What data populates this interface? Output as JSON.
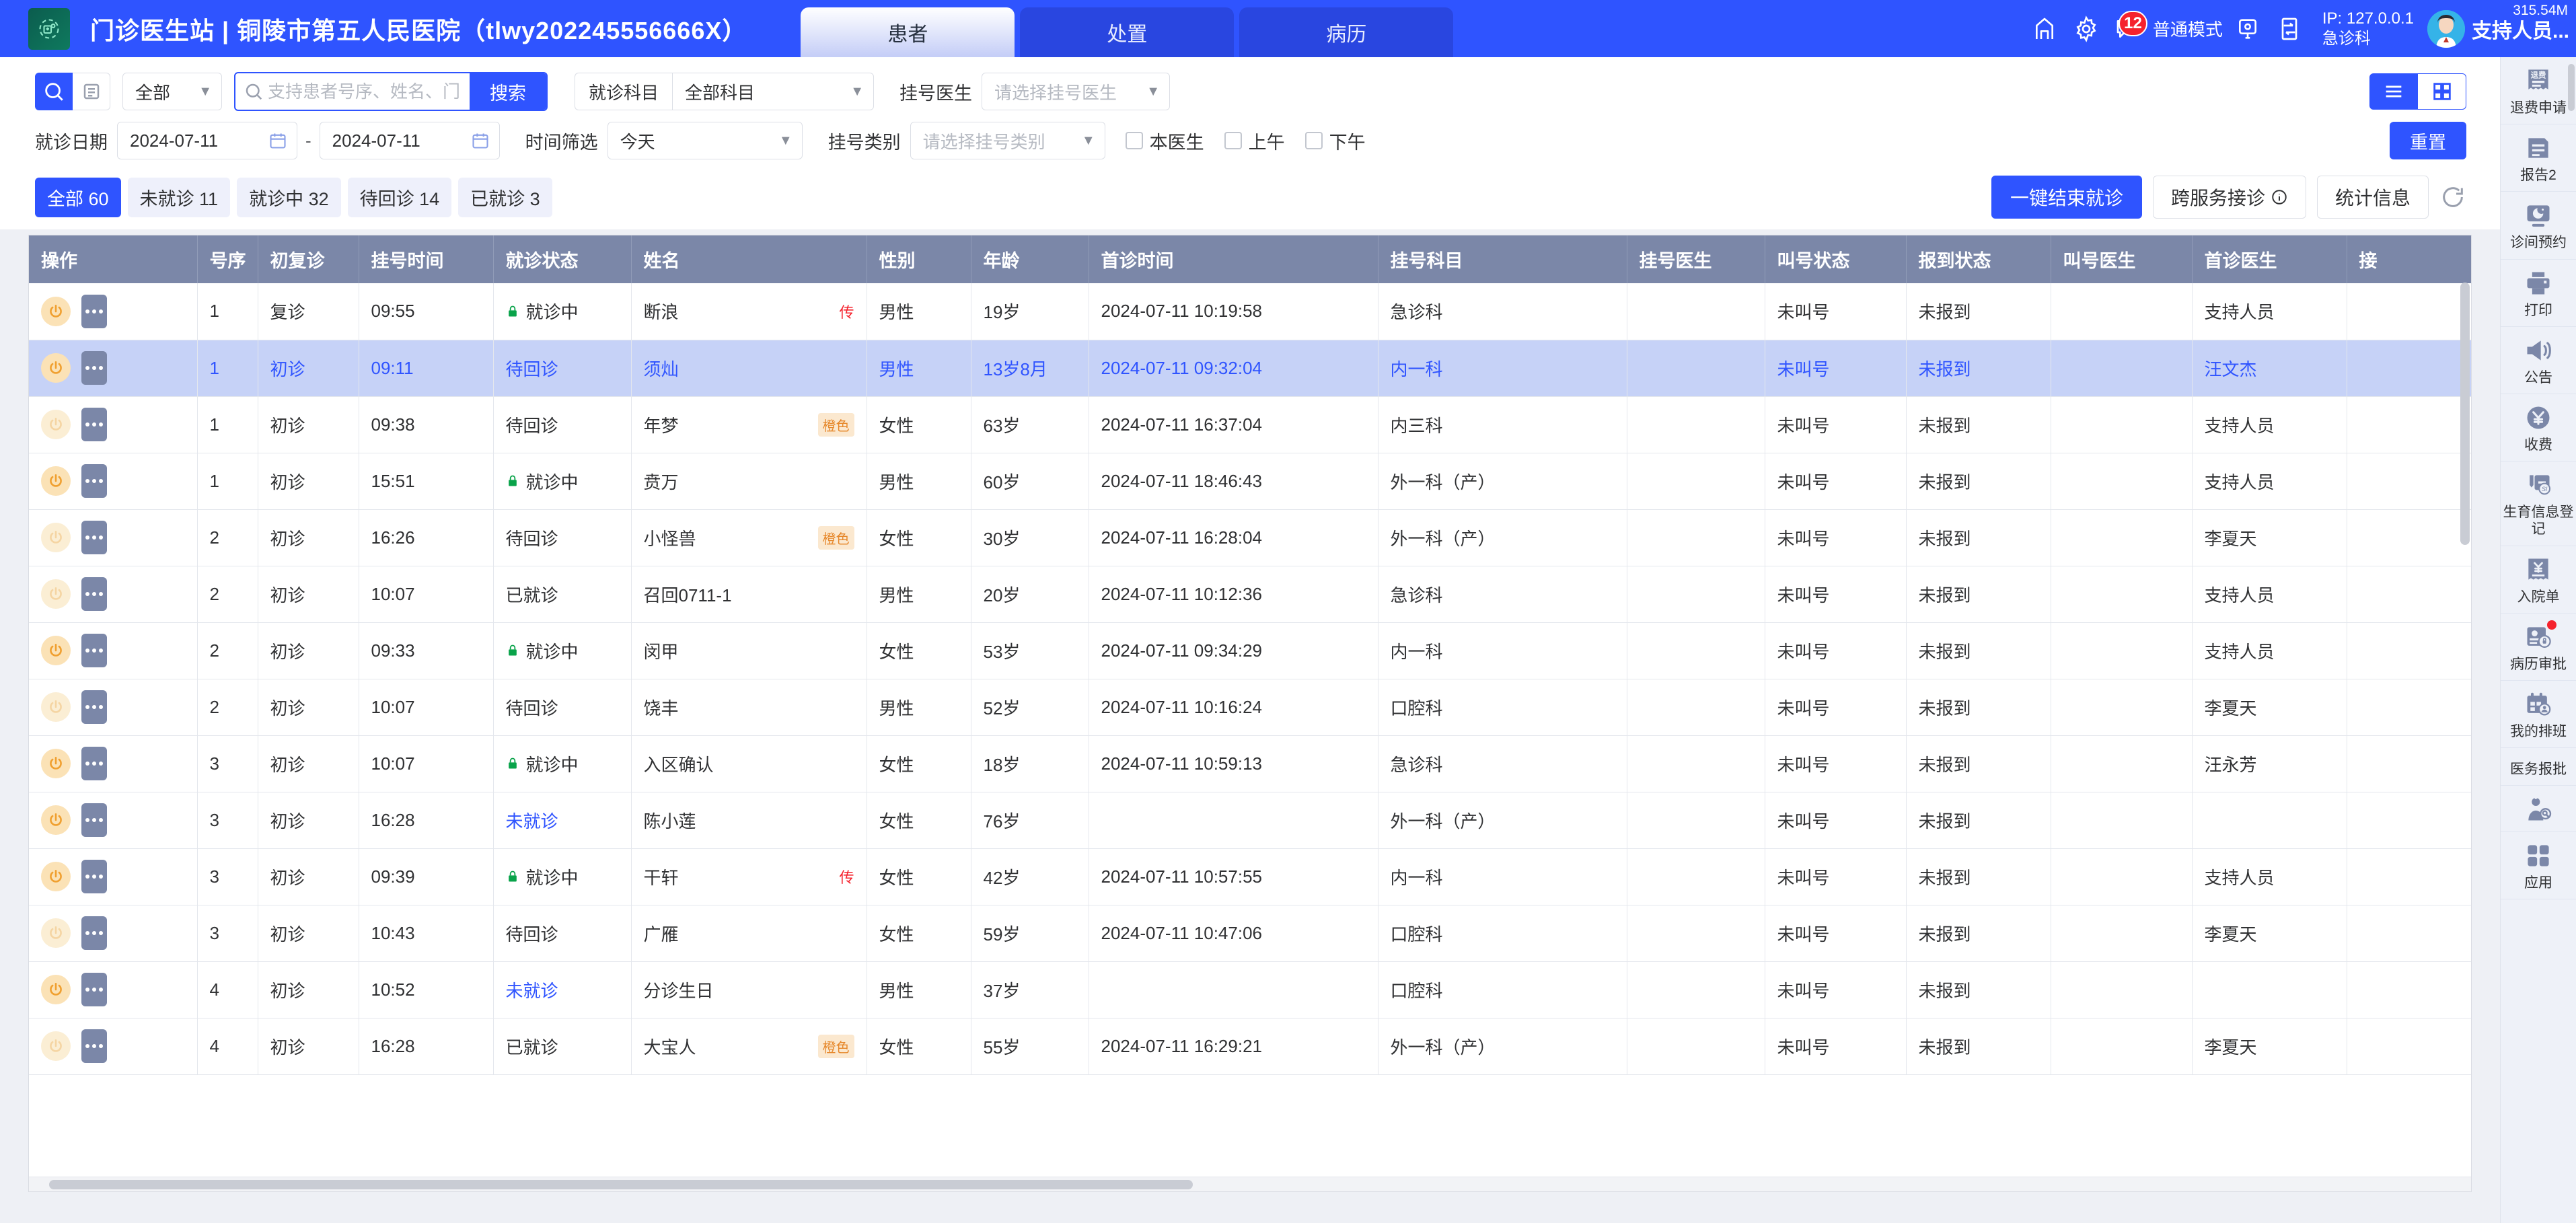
{
  "header": {
    "logo_icon": "hospital-logo-icon",
    "title": "门诊医生站 | 铜陵市第五人民医院（tlwy202245556666X）",
    "tabs": [
      {
        "label": "患者",
        "active": true
      },
      {
        "label": "处置",
        "active": false
      },
      {
        "label": "病历",
        "active": false
      }
    ],
    "icons": {
      "home": "home-icon",
      "settings": "gear-icon",
      "message": "message-icon",
      "screen": "screen-icon",
      "switch": "switch-icon"
    },
    "message_count": "12",
    "mode_label": "普通模式",
    "ip_line1": "IP: 127.0.0.1",
    "ip_line2": "急诊科",
    "user_name": "支持人员...",
    "memory": "315.54M"
  },
  "filters": {
    "search_icon": "search-icon",
    "list_icon": "list-icon",
    "scope_select": "全部",
    "search_placeholder": "支持患者号序、姓名、门",
    "search_value": "",
    "search_button": "搜索",
    "dept_label": "就诊科目",
    "dept_value": "全部科目",
    "reg_doctor_label": "挂号医生",
    "reg_doctor_placeholder": "请选择挂号医生",
    "view_list_icon": "list-view-icon",
    "view_grid_icon": "grid-view-icon",
    "visit_date_label": "就诊日期",
    "date_start": "2024-07-11",
    "date_end": "2024-07-11",
    "date_sep": "-",
    "calendar_icon": "calendar-icon",
    "time_filter_label": "时间筛选",
    "time_filter_value": "今天",
    "reg_type_label": "挂号类别",
    "reg_type_placeholder": "请选择挂号类别",
    "checkboxes": [
      {
        "label": "本医生",
        "checked": false
      },
      {
        "label": "上午",
        "checked": false
      },
      {
        "label": "下午",
        "checked": false
      }
    ],
    "reset_button": "重置"
  },
  "status_tabs": [
    {
      "label": "全部 60",
      "active": true
    },
    {
      "label": "未就诊 11",
      "active": false
    },
    {
      "label": "就诊中 32",
      "active": false
    },
    {
      "label": "待回诊 14",
      "active": false
    },
    {
      "label": "已就诊 3",
      "active": false
    }
  ],
  "actions": {
    "end_visit": "一键结束就诊",
    "cross_service": "跨服务接诊",
    "info_icon": "info-icon",
    "statistics": "统计信息",
    "refresh_icon": "refresh-icon"
  },
  "table": {
    "columns": [
      "操作",
      "号序",
      "初复诊",
      "挂号时间",
      "就诊状态",
      "姓名",
      "性别",
      "年龄",
      "首诊时间",
      "挂号科目",
      "挂号医生",
      "叫号状态",
      "报到状态",
      "叫号医生",
      "首诊医生",
      "接"
    ],
    "rows": [
      {
        "seq": "1",
        "visit_type": "复诊",
        "reg_time": "09:55",
        "status": "就诊中",
        "status_kind": "active",
        "name": "断浪",
        "name_tag": "传",
        "tag_kind": "chuan",
        "gender": "男性",
        "age": "19岁",
        "first_visit_time": "2024-07-11 10:19:58",
        "reg_dept": "急诊科",
        "reg_doctor": "",
        "call_status": "未叫号",
        "checkin_status": "未报到",
        "call_doctor": "",
        "first_doctor": "支持人员",
        "selected": false,
        "power_dim": false
      },
      {
        "seq": "1",
        "visit_type": "初诊",
        "reg_time": "09:11",
        "status": "待回诊",
        "status_kind": "plain",
        "name": "须灿",
        "name_tag": "",
        "tag_kind": "",
        "gender": "男性",
        "age": "13岁8月",
        "first_visit_time": "2024-07-11 09:32:04",
        "reg_dept": "内一科",
        "reg_doctor": "",
        "call_status": "未叫号",
        "checkin_status": "未报到",
        "call_doctor": "",
        "first_doctor": "汪文杰",
        "selected": true,
        "power_dim": false
      },
      {
        "seq": "1",
        "visit_type": "初诊",
        "reg_time": "09:38",
        "status": "待回诊",
        "status_kind": "plain",
        "name": "年梦",
        "name_tag": "橙色",
        "tag_kind": "orange",
        "gender": "女性",
        "age": "63岁",
        "first_visit_time": "2024-07-11 16:37:04",
        "reg_dept": "内三科",
        "reg_doctor": "",
        "call_status": "未叫号",
        "checkin_status": "未报到",
        "call_doctor": "",
        "first_doctor": "支持人员",
        "selected": false,
        "power_dim": true
      },
      {
        "seq": "1",
        "visit_type": "初诊",
        "reg_time": "15:51",
        "status": "就诊中",
        "status_kind": "active",
        "name": "贲万",
        "name_tag": "",
        "tag_kind": "",
        "gender": "男性",
        "age": "60岁",
        "first_visit_time": "2024-07-11 18:46:43",
        "reg_dept": "外一科（产）",
        "reg_doctor": "",
        "call_status": "未叫号",
        "checkin_status": "未报到",
        "call_doctor": "",
        "first_doctor": "支持人员",
        "selected": false,
        "power_dim": false
      },
      {
        "seq": "2",
        "visit_type": "初诊",
        "reg_time": "16:26",
        "status": "待回诊",
        "status_kind": "plain",
        "name": "小怪兽",
        "name_tag": "橙色",
        "tag_kind": "orange",
        "gender": "女性",
        "age": "30岁",
        "first_visit_time": "2024-07-11 16:28:04",
        "reg_dept": "外一科（产）",
        "reg_doctor": "",
        "call_status": "未叫号",
        "checkin_status": "未报到",
        "call_doctor": "",
        "first_doctor": "李夏天",
        "selected": false,
        "power_dim": true
      },
      {
        "seq": "2",
        "visit_type": "初诊",
        "reg_time": "10:07",
        "status": "已就诊",
        "status_kind": "plain",
        "name": "召回0711-1",
        "name_tag": "",
        "tag_kind": "",
        "gender": "男性",
        "age": "20岁",
        "first_visit_time": "2024-07-11 10:12:36",
        "reg_dept": "急诊科",
        "reg_doctor": "",
        "call_status": "未叫号",
        "checkin_status": "未报到",
        "call_doctor": "",
        "first_doctor": "支持人员",
        "selected": false,
        "power_dim": true
      },
      {
        "seq": "2",
        "visit_type": "初诊",
        "reg_time": "09:33",
        "status": "就诊中",
        "status_kind": "active",
        "name": "闵甲",
        "name_tag": "",
        "tag_kind": "",
        "gender": "女性",
        "age": "53岁",
        "first_visit_time": "2024-07-11 09:34:29",
        "reg_dept": "内一科",
        "reg_doctor": "",
        "call_status": "未叫号",
        "checkin_status": "未报到",
        "call_doctor": "",
        "first_doctor": "支持人员",
        "selected": false,
        "power_dim": false
      },
      {
        "seq": "2",
        "visit_type": "初诊",
        "reg_time": "10:07",
        "status": "待回诊",
        "status_kind": "plain",
        "name": "饶丰",
        "name_tag": "",
        "tag_kind": "",
        "gender": "男性",
        "age": "52岁",
        "first_visit_time": "2024-07-11 10:16:24",
        "reg_dept": "口腔科",
        "reg_doctor": "",
        "call_status": "未叫号",
        "checkin_status": "未报到",
        "call_doctor": "",
        "first_doctor": "李夏天",
        "selected": false,
        "power_dim": true
      },
      {
        "seq": "3",
        "visit_type": "初诊",
        "reg_time": "10:07",
        "status": "就诊中",
        "status_kind": "active",
        "name": "入区确认",
        "name_tag": "",
        "tag_kind": "",
        "gender": "女性",
        "age": "18岁",
        "first_visit_time": "2024-07-11 10:59:13",
        "reg_dept": "急诊科",
        "reg_doctor": "",
        "call_status": "未叫号",
        "checkin_status": "未报到",
        "call_doctor": "",
        "first_doctor": "汪永芳",
        "selected": false,
        "power_dim": false
      },
      {
        "seq": "3",
        "visit_type": "初诊",
        "reg_time": "16:28",
        "status": "未就诊",
        "status_kind": "link",
        "name": "陈小莲",
        "name_tag": "",
        "tag_kind": "",
        "gender": "女性",
        "age": "76岁",
        "first_visit_time": "",
        "reg_dept": "外一科（产）",
        "reg_doctor": "",
        "call_status": "未叫号",
        "checkin_status": "未报到",
        "call_doctor": "",
        "first_doctor": "",
        "selected": false,
        "power_dim": false
      },
      {
        "seq": "3",
        "visit_type": "初诊",
        "reg_time": "09:39",
        "status": "就诊中",
        "status_kind": "active",
        "name": "干轩",
        "name_tag": "传",
        "tag_kind": "chuan",
        "gender": "女性",
        "age": "42岁",
        "first_visit_time": "2024-07-11 10:57:55",
        "reg_dept": "内一科",
        "reg_doctor": "",
        "call_status": "未叫号",
        "checkin_status": "未报到",
        "call_doctor": "",
        "first_doctor": "支持人员",
        "selected": false,
        "power_dim": false
      },
      {
        "seq": "3",
        "visit_type": "初诊",
        "reg_time": "10:43",
        "status": "待回诊",
        "status_kind": "plain",
        "name": "广雁",
        "name_tag": "",
        "tag_kind": "",
        "gender": "女性",
        "age": "59岁",
        "first_visit_time": "2024-07-11 10:47:06",
        "reg_dept": "口腔科",
        "reg_doctor": "",
        "call_status": "未叫号",
        "checkin_status": "未报到",
        "call_doctor": "",
        "first_doctor": "李夏天",
        "selected": false,
        "power_dim": true
      },
      {
        "seq": "4",
        "visit_type": "初诊",
        "reg_time": "10:52",
        "status": "未就诊",
        "status_kind": "link",
        "name": "分诊生日",
        "name_tag": "",
        "tag_kind": "",
        "gender": "男性",
        "age": "37岁",
        "first_visit_time": "",
        "reg_dept": "口腔科",
        "reg_doctor": "",
        "call_status": "未叫号",
        "checkin_status": "未报到",
        "call_doctor": "",
        "first_doctor": "",
        "selected": false,
        "power_dim": false
      },
      {
        "seq": "4",
        "visit_type": "初诊",
        "reg_time": "16:28",
        "status": "已就诊",
        "status_kind": "plain",
        "name": "大宝人",
        "name_tag": "橙色",
        "tag_kind": "orange",
        "gender": "女性",
        "age": "55岁",
        "first_visit_time": "2024-07-11 16:29:21",
        "reg_dept": "外一科（产）",
        "reg_doctor": "",
        "call_status": "未叫号",
        "checkin_status": "未报到",
        "call_doctor": "",
        "first_doctor": "李夏天",
        "selected": false,
        "power_dim": true
      }
    ]
  },
  "rail": [
    {
      "label": "退费申请",
      "icon": "refund-icon",
      "badge": false
    },
    {
      "label": "报告2",
      "icon": "report-icon",
      "badge": false
    },
    {
      "label": "诊间预约",
      "icon": "appointment-icon",
      "badge": false
    },
    {
      "label": "打印",
      "icon": "printer-icon",
      "badge": false
    },
    {
      "label": "公告",
      "icon": "announcement-icon",
      "badge": false
    },
    {
      "label": "收费",
      "icon": "payment-icon",
      "badge": false
    },
    {
      "label": "生育信息登记",
      "icon": "birth-registration-icon",
      "badge": false
    },
    {
      "label": "入院单",
      "icon": "admission-form-icon",
      "badge": false
    },
    {
      "label": "病历审批",
      "icon": "record-approval-icon",
      "badge": true
    },
    {
      "label": "我的排班",
      "icon": "my-schedule-icon",
      "badge": false
    },
    {
      "label": "医务报批",
      "icon": "medical-approval-icon",
      "badge": false
    },
    {
      "label": "",
      "icon": "doctor-search-icon",
      "badge": false
    },
    {
      "label": "应用",
      "icon": "apps-icon",
      "badge": false
    }
  ],
  "colors": {
    "brand": "#2f54ff",
    "header_row": "#7b87a8",
    "selected_row": "#c6d2f7",
    "active_green": "#09a34a",
    "tag_orange": "#e6872a",
    "danger": "#f5222d"
  }
}
